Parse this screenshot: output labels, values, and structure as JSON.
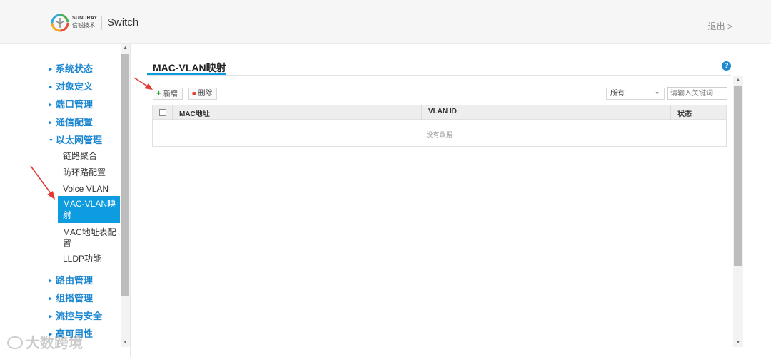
{
  "header": {
    "brand_en": "SUNDRAY",
    "brand_cn": "信锐技术",
    "product": "Switch",
    "logout": "退出 >"
  },
  "sidebar": {
    "items": [
      {
        "label": "系统状态",
        "expanded": false
      },
      {
        "label": "对象定义",
        "expanded": false
      },
      {
        "label": "端口管理",
        "expanded": false
      },
      {
        "label": "通信配置",
        "expanded": false
      },
      {
        "label": "以太网管理",
        "expanded": true
      },
      {
        "label": "路由管理",
        "expanded": false
      },
      {
        "label": "组播管理",
        "expanded": false
      },
      {
        "label": "流控与安全",
        "expanded": false
      },
      {
        "label": "高可用性",
        "expanded": false
      }
    ],
    "sub_items": [
      {
        "label": "链路聚合"
      },
      {
        "label": "防环路配置"
      },
      {
        "label": "Voice VLAN"
      },
      {
        "label": "MAC-VLAN映射",
        "active": true
      },
      {
        "label": "MAC地址表配置"
      },
      {
        "label": "LLDP功能"
      }
    ]
  },
  "main": {
    "title": "MAC-VLAN映射",
    "help": "?",
    "toolbar": {
      "add_label": "新增",
      "delete_label": "删除",
      "filter_value": "所有",
      "search_placeholder": "请输入关键词"
    },
    "table": {
      "columns": [
        "MAC地址",
        "VLAN ID",
        "状态"
      ],
      "rows": [],
      "empty_text": "没有数据"
    }
  },
  "watermark": "大数跨境",
  "colors": {
    "accent": "#0d9ce0",
    "nav_text": "#1e88d2",
    "annotation_arrow": "#e53935"
  }
}
